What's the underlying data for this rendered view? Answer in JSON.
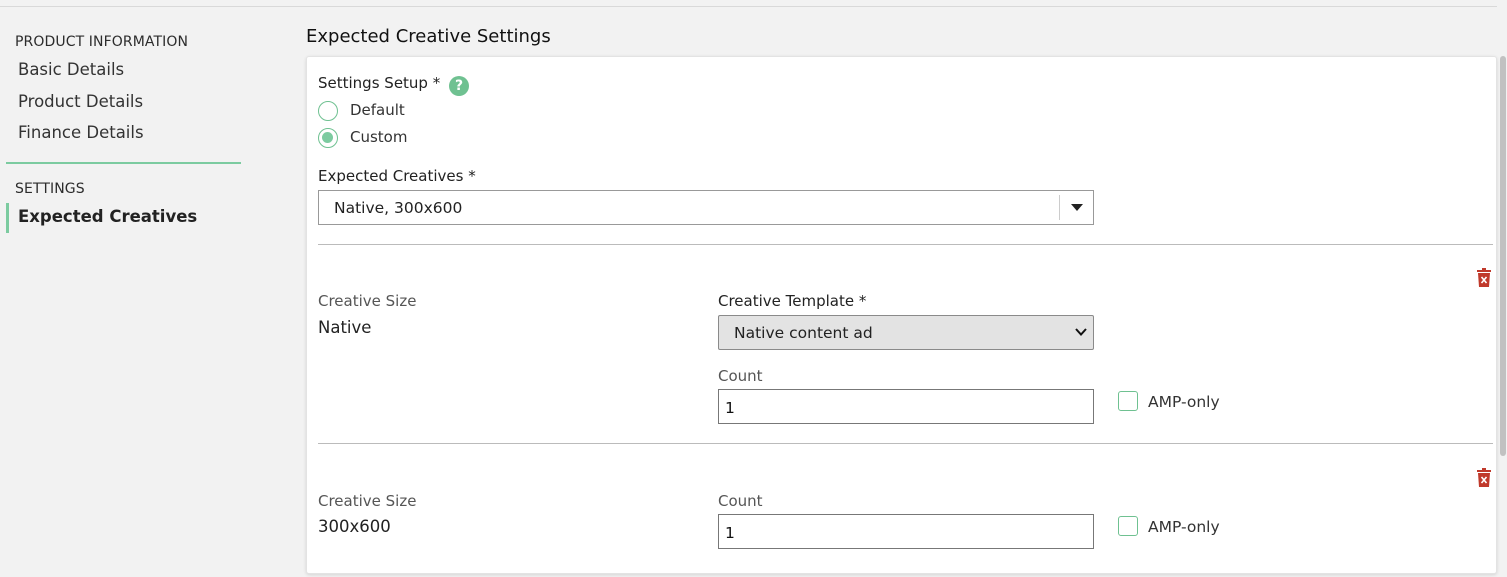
{
  "sidebar": {
    "sections": [
      {
        "heading": "PRODUCT INFORMATION",
        "items": [
          "Basic Details",
          "Product Details",
          "Finance Details"
        ]
      },
      {
        "heading": "SETTINGS",
        "items": [
          "Expected Creatives"
        ]
      }
    ],
    "active_item": "Expected Creatives"
  },
  "main": {
    "title": "Expected Creative Settings",
    "settings_setup": {
      "label": "Settings Setup *",
      "help_icon": "?",
      "options": [
        "Default",
        "Custom"
      ],
      "selected": "Custom"
    },
    "expected_creatives": {
      "label": "Expected Creatives *",
      "value": "Native, 300x600"
    },
    "creatives": [
      {
        "size_label": "Creative Size",
        "size_value": "Native",
        "template_label": "Creative Template *",
        "template_value": "Native content ad",
        "count_label": "Count",
        "count_value": "1",
        "amp_label": "AMP-only",
        "amp_checked": false
      },
      {
        "size_label": "Creative Size",
        "size_value": "300x600",
        "count_label": "Count",
        "count_value": "1",
        "amp_label": "AMP-only",
        "amp_checked": false
      }
    ]
  },
  "colors": {
    "accent": "#7ccba0",
    "delete": "#c0392b",
    "background": "#f2f2f2"
  }
}
